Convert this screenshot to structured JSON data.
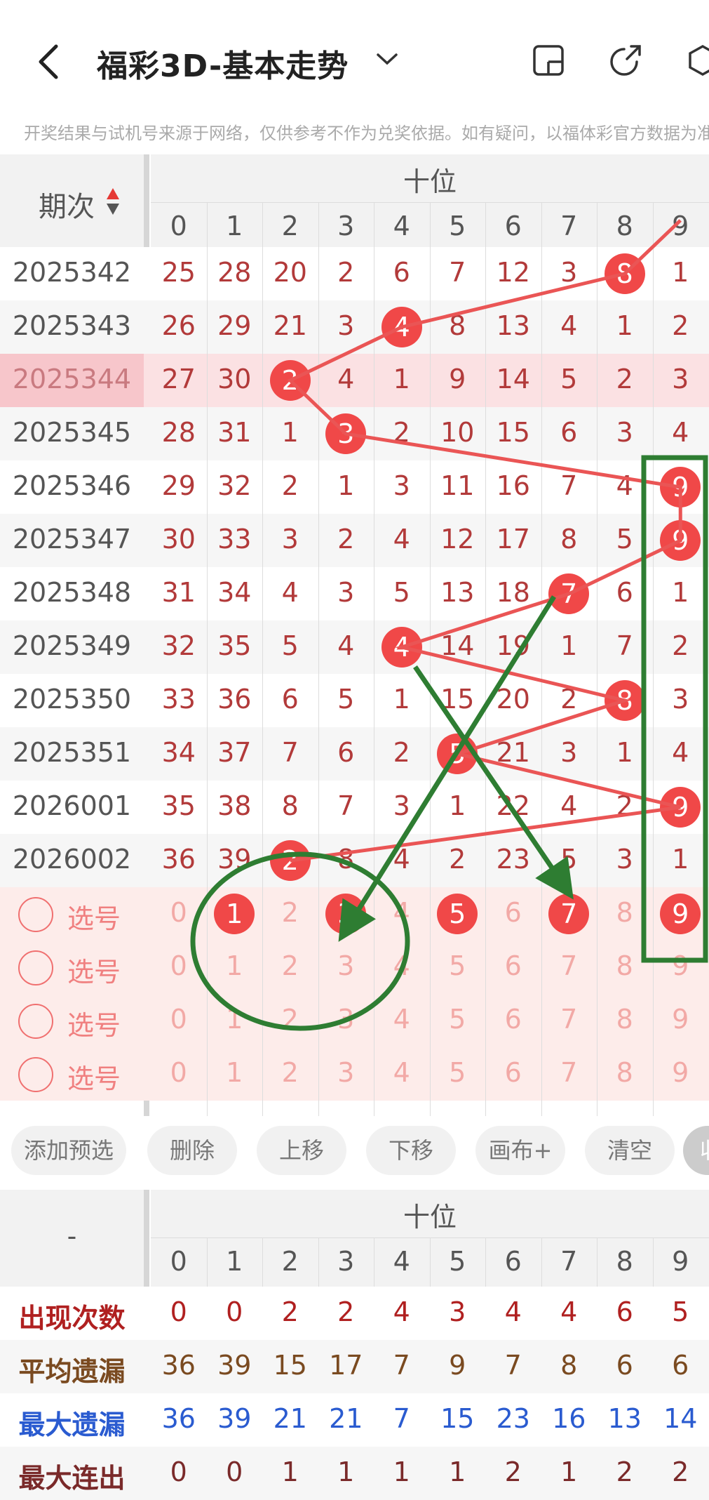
{
  "header": {
    "title": "福彩3D-基本走势"
  },
  "notice": "开奖结果与试机号来源于网络，仅供参考不作为兑奖依据。如有疑问，以福体彩官方数据为准",
  "table": {
    "period_header": "期次",
    "group_header": "十位",
    "digits": [
      "0",
      "1",
      "2",
      "3",
      "4",
      "5",
      "6",
      "7",
      "8",
      "9"
    ],
    "rows": [
      {
        "period": "2025342",
        "cells": [
          "25",
          "28",
          "20",
          "2",
          "6",
          "7",
          "12",
          "3",
          "8",
          "1"
        ],
        "hit": 8
      },
      {
        "period": "2025343",
        "cells": [
          "26",
          "29",
          "21",
          "3",
          "4",
          "8",
          "13",
          "4",
          "1",
          "2"
        ],
        "hit": 4
      },
      {
        "period": "2025344",
        "cells": [
          "27",
          "30",
          "2",
          "4",
          "1",
          "9",
          "14",
          "5",
          "2",
          "3"
        ],
        "hit": 2
      },
      {
        "period": "2025345",
        "cells": [
          "28",
          "31",
          "1",
          "3",
          "2",
          "10",
          "15",
          "6",
          "3",
          "4"
        ],
        "hit": 3
      },
      {
        "period": "2025346",
        "cells": [
          "29",
          "32",
          "2",
          "1",
          "3",
          "11",
          "16",
          "7",
          "4",
          "9"
        ],
        "hit": 9
      },
      {
        "period": "2025347",
        "cells": [
          "30",
          "33",
          "3",
          "2",
          "4",
          "12",
          "17",
          "8",
          "5",
          "9"
        ],
        "hit": 9
      },
      {
        "period": "2025348",
        "cells": [
          "31",
          "34",
          "4",
          "3",
          "5",
          "13",
          "18",
          "7",
          "6",
          "1"
        ],
        "hit": 7
      },
      {
        "period": "2025349",
        "cells": [
          "32",
          "35",
          "5",
          "4",
          "4",
          "14",
          "19",
          "1",
          "7",
          "2"
        ],
        "hit": 4
      },
      {
        "period": "2025350",
        "cells": [
          "33",
          "36",
          "6",
          "5",
          "1",
          "15",
          "20",
          "2",
          "8",
          "3"
        ],
        "hit": 8
      },
      {
        "period": "2025351",
        "cells": [
          "34",
          "37",
          "7",
          "6",
          "2",
          "5",
          "21",
          "3",
          "1",
          "4"
        ],
        "hit": 5
      },
      {
        "period": "2026001",
        "cells": [
          "35",
          "38",
          "8",
          "7",
          "3",
          "1",
          "22",
          "4",
          "2",
          "9"
        ],
        "hit": 9
      },
      {
        "period": "2026002",
        "cells": [
          "36",
          "39",
          "2",
          "8",
          "4",
          "2",
          "23",
          "5",
          "3",
          "1"
        ],
        "hit": 2
      }
    ],
    "pick_label": "选号",
    "pick_rows": [
      {
        "selected": [
          1,
          3,
          5,
          7,
          9
        ]
      },
      {
        "selected": []
      },
      {
        "selected": []
      },
      {
        "selected": []
      }
    ]
  },
  "buttons": [
    "添加预选",
    "删除",
    "上移",
    "下移",
    "画布+",
    "清空",
    "收"
  ],
  "stats": {
    "corner": "-",
    "group_header": "十位",
    "rows": [
      {
        "label": "出现次数",
        "color": "#b02020",
        "values": [
          "0",
          "0",
          "2",
          "2",
          "4",
          "3",
          "4",
          "4",
          "6",
          "5"
        ]
      },
      {
        "label": "平均遗漏",
        "color": "#7a4a20",
        "values": [
          "36",
          "39",
          "15",
          "17",
          "7",
          "9",
          "7",
          "8",
          "6",
          "6"
        ]
      },
      {
        "label": "最大遗漏",
        "color": "#2a5bd0",
        "values": [
          "36",
          "39",
          "21",
          "21",
          "7",
          "15",
          "23",
          "16",
          "13",
          "14"
        ]
      },
      {
        "label": "最大连出",
        "color": "#7a2a2a",
        "values": [
          "0",
          "0",
          "1",
          "1",
          "1",
          "1",
          "2",
          "1",
          "2",
          "2"
        ]
      }
    ]
  },
  "colors": {
    "ball": "#f04848",
    "annot": "#2e7d32",
    "highlight": "#fadadd",
    "pick_bg": "#fdecea"
  }
}
